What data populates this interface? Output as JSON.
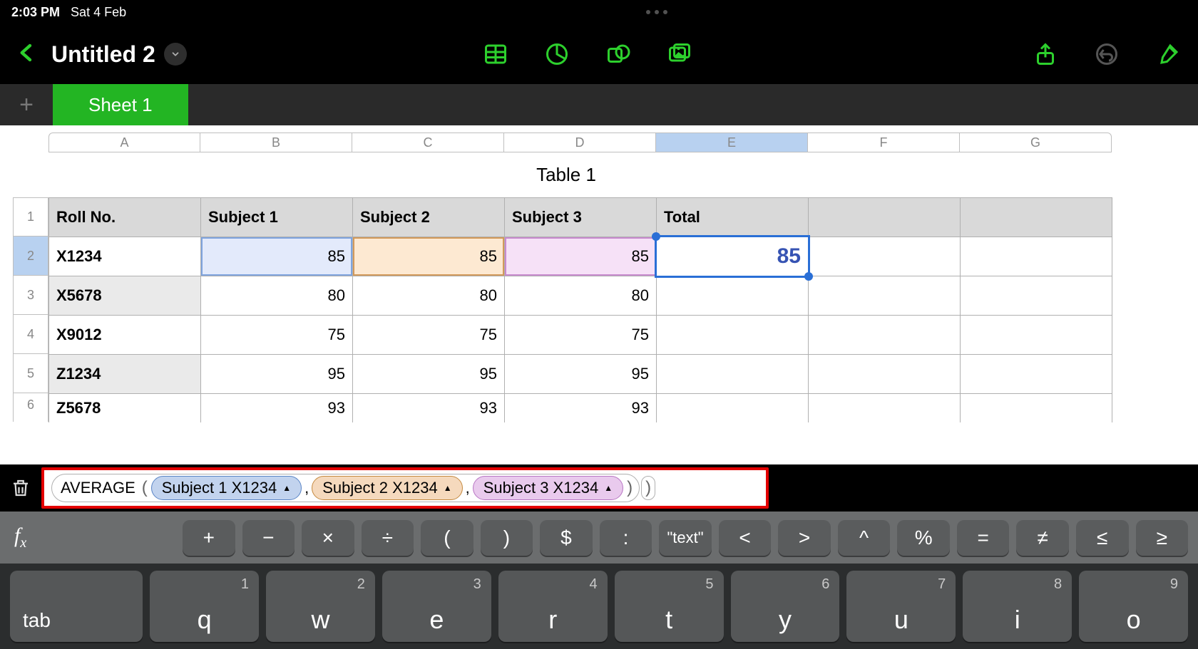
{
  "status": {
    "time": "2:03 PM",
    "date": "Sat 4 Feb"
  },
  "doc": {
    "title": "Untitled 2"
  },
  "sheet_tab": "Sheet 1",
  "columns": [
    "A",
    "B",
    "C",
    "D",
    "E",
    "F",
    "G"
  ],
  "selected_column_index": 4,
  "selected_row_index": 1,
  "table_title": "Table 1",
  "headers": [
    "Roll No.",
    "Subject 1",
    "Subject 2",
    "Subject 3",
    "Total",
    "",
    ""
  ],
  "row_numbers": [
    "1",
    "2",
    "3",
    "4",
    "5",
    "6"
  ],
  "rows": [
    {
      "roll": "X1234",
      "s1": "85",
      "s2": "85",
      "s3": "85",
      "total": "85"
    },
    {
      "roll": "X5678",
      "s1": "80",
      "s2": "80",
      "s3": "80",
      "total": ""
    },
    {
      "roll": "X9012",
      "s1": "75",
      "s2": "75",
      "s3": "75",
      "total": ""
    },
    {
      "roll": "Z1234",
      "s1": "95",
      "s2": "95",
      "s3": "95",
      "total": ""
    },
    {
      "roll": "Z5678",
      "s1": "93",
      "s2": "93",
      "s3": "93",
      "total": ""
    }
  ],
  "formula": {
    "func": "AVERAGE",
    "args": [
      {
        "label": "Subject 1 X1234",
        "color": "blue"
      },
      {
        "label": "Subject 2 X1234",
        "color": "orange"
      },
      {
        "label": "Subject 3 X1234",
        "color": "purple"
      }
    ]
  },
  "op_keys": [
    "+",
    "−",
    "×",
    "÷",
    "(",
    ")",
    "$",
    ":",
    "\"text\"",
    "<",
    ">",
    "^",
    "%",
    "=",
    "≠",
    "≤",
    "≥"
  ],
  "fx_label": "f",
  "fx_sub": "x",
  "kbd_keys": [
    {
      "letter": "tab",
      "digit": "",
      "special": "tab"
    },
    {
      "letter": "q",
      "digit": "1"
    },
    {
      "letter": "w",
      "digit": "2"
    },
    {
      "letter": "e",
      "digit": "3"
    },
    {
      "letter": "r",
      "digit": "4"
    },
    {
      "letter": "t",
      "digit": "5"
    },
    {
      "letter": "y",
      "digit": "6"
    },
    {
      "letter": "u",
      "digit": "7"
    },
    {
      "letter": "i",
      "digit": "8"
    },
    {
      "letter": "o",
      "digit": "9"
    }
  ]
}
